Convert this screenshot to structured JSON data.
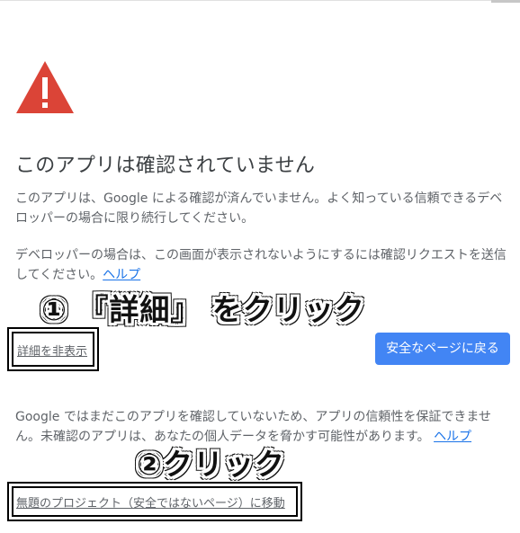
{
  "title": "このアプリは確認されていません",
  "paragraph1": "このアプリは、Google による確認が済んでいません。よく知っている信頼できるデベロッパーの場合に限り続行してください。",
  "paragraph2_text": "デベロッパーの場合は、この画面が表示されないようにするには確認リクエストを送信してください。",
  "paragraph2_link": "ヘルプ",
  "callout1": "① 『詳細』 をクリック",
  "hide_details_link": "詳細を非表示",
  "back_to_safety_button": "安全なページに戻る",
  "paragraph3_text": "Google ではまだこのアプリを確認していないため、アプリの信頼性を保証できません。未確認のアプリは、あなたの個人データを脅かす可能性があります。",
  "paragraph3_link": "ヘルプ",
  "callout2": "②クリック",
  "go_to_unsafe_link": "無題のプロジェクト（安全ではないページ）に移動",
  "icons": {
    "warning": "warning-triangle-icon"
  },
  "colors": {
    "warning": "#db4437",
    "button": "#4285f4",
    "link": "#1a73e8"
  }
}
